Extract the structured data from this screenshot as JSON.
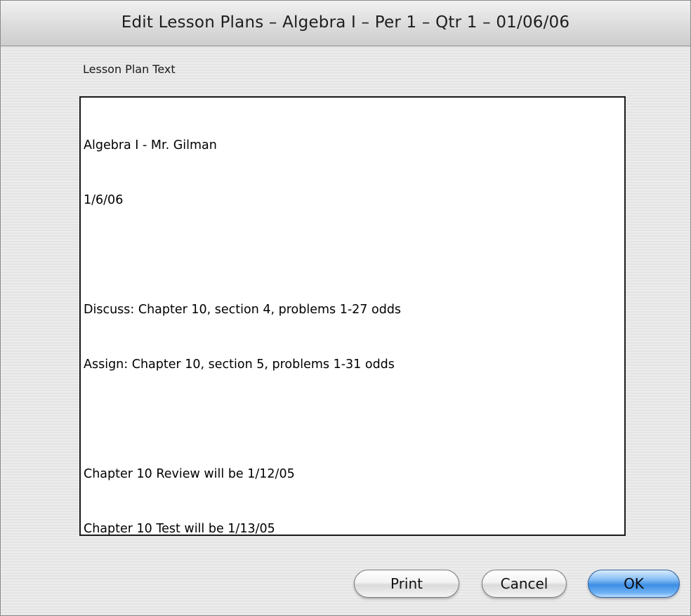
{
  "window": {
    "title": "Edit Lesson Plans – Algebra I – Per 1 – Qtr 1 – 01/06/06"
  },
  "lesson": {
    "label": "Lesson Plan Text",
    "lines": [
      "Algebra I - Mr. Gilman",
      "1/6/06",
      "",
      "Discuss: Chapter 10, section 4, problems 1-27 odds",
      "Assign: Chapter 10, section 5, problems 1-31 odds",
      "",
      "Chapter 10 Review will be 1/12/05",
      "Chapter 10 Test will be 1/13/05"
    ]
  },
  "buttons": {
    "print": "Print",
    "cancel": "Cancel",
    "ok": "OK"
  },
  "colors": {
    "default_button": "#3d8ee4",
    "text": "#000000"
  }
}
